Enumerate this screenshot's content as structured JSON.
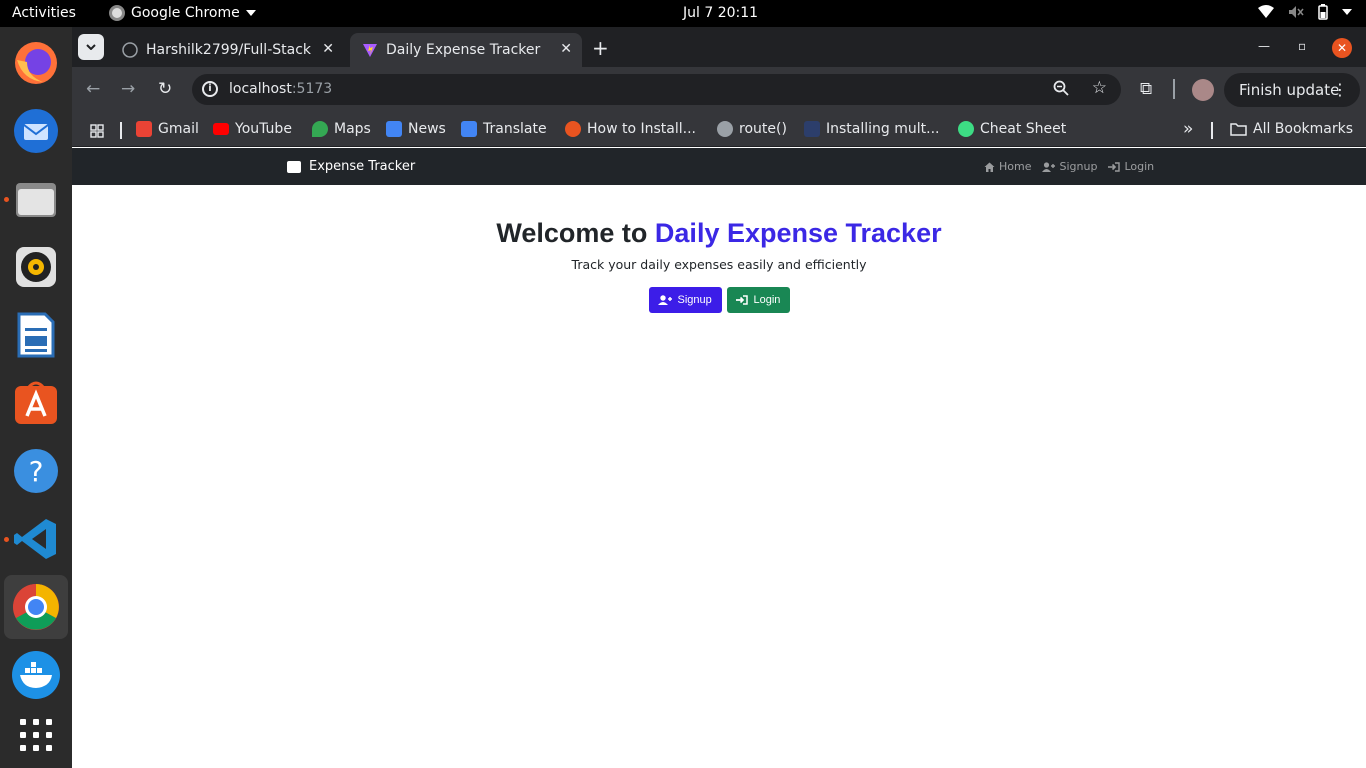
{
  "system": {
    "activities": "Activities",
    "app_name": "Google Chrome",
    "clock": "Jul 7  20:11"
  },
  "dock": {
    "items": [
      "firefox",
      "thunderbird",
      "files",
      "rhythmbox",
      "libreoffice-writer",
      "app-center",
      "help",
      "vscode",
      "chrome",
      "docker",
      "show-apps"
    ]
  },
  "browser": {
    "tabs": [
      {
        "title": "Harshilk2799/Full-Stack-",
        "active": false
      },
      {
        "title": "Daily Expense Tracker",
        "active": true
      }
    ],
    "url_host": "localhost",
    "url_port": ":5173",
    "finish_update": "Finish update",
    "bookmarks": [
      {
        "label": "Gmail",
        "color": "#ea4335"
      },
      {
        "label": "YouTube",
        "color": "#ff0000"
      },
      {
        "label": "Maps",
        "color": "#34a853"
      },
      {
        "label": "News",
        "color": "#4285f4"
      },
      {
        "label": "Translate",
        "color": "#4285f4"
      },
      {
        "label": "How to Install...",
        "color": "#e95420"
      },
      {
        "label": "route()",
        "color": "#9aa0a6"
      },
      {
        "label": "Installing mult...",
        "color": "#2c3e6b"
      },
      {
        "label": "Cheat Sheet",
        "color": "#3ddc84"
      }
    ],
    "all_bookmarks": "All Bookmarks"
  },
  "app": {
    "brand": "Expense Tracker",
    "nav": {
      "home": "Home",
      "signup": "Signup",
      "login": "Login"
    },
    "hero": {
      "title_prefix": "Welcome to ",
      "title_accent": "Daily Expense Tracker",
      "subtitle": "Track your daily expenses easily and efficiently",
      "signup_button": "Signup",
      "login_button": "Login"
    },
    "colors": {
      "accent": "#3b28e5",
      "signup_btn": "#3c1de8",
      "login_btn": "#198754",
      "navbar": "#212529"
    }
  }
}
